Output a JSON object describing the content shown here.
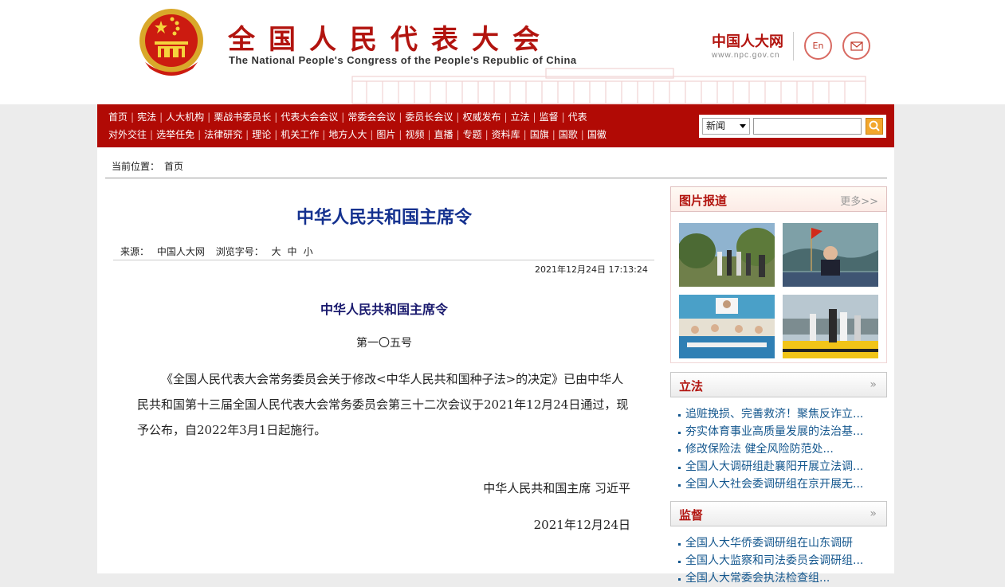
{
  "header": {
    "title_cn": "全国人民代表大会",
    "title_en": "The National People's Congress of the People's Republic of China",
    "npc_logo_cn": "中国人大网",
    "npc_logo_url": "www.npc.gov.cn",
    "en_button": "En",
    "mail_icon": "mail-icon",
    "emblem_icon": "national-emblem-icon",
    "brand_color": "#b2140f"
  },
  "nav": {
    "row1": [
      "首页",
      "宪法",
      "人大机构",
      "栗战书委员长",
      "代表大会会议",
      "常委会会议",
      "委员长会议",
      "权威发布",
      "立法",
      "监督",
      "代表"
    ],
    "row2": [
      "对外交往",
      "选举任免",
      "法律研究",
      "理论",
      "机关工作",
      "地方人大",
      "图片",
      "视频",
      "直播",
      "专题",
      "资料库",
      "国旗",
      "国歌",
      "国徽"
    ],
    "bg_color": "#b10a05"
  },
  "search": {
    "category": "新闻",
    "placeholder": "",
    "button_icon": "search-icon"
  },
  "breadcrumb": {
    "label": "当前位置：",
    "home": "首页"
  },
  "article": {
    "title": "中华人民共和国主席令",
    "source_label": "来源：",
    "source": "中国人大网",
    "font_label": "浏览字号：",
    "font_sizes": [
      "大",
      "中",
      "小"
    ],
    "datetime": "2021年12月24日 17:13:24",
    "order_title": "中华人民共和国主席令",
    "order_number": "第一〇五号",
    "body": "《全国人民代表大会常务委员会关于修改<中华人民共和国种子法>的决定》已由中华人民共和国第十三届全国人民代表大会常务委员会第三十二次会议于2021年12月24日通过，现予公布，自2022年3月1日起施行。",
    "signature": "中华人民共和国主席 习近平",
    "sign_date": "2021年12月24日"
  },
  "sidebar": {
    "photo_news": {
      "title": "图片报道",
      "more": "更多>>"
    },
    "legislation": {
      "title": "立法",
      "items": [
        "追赃挽损、完善救济！聚焦反诈立...",
        "夯实体育事业高质量发展的法治基...",
        "修改保险法 健全风险防范处...",
        "全国人大调研组赴襄阳开展立法调...",
        "全国人大社会委调研组在京开展无..."
      ]
    },
    "supervision": {
      "title": "监督",
      "items": [
        "全国人大华侨委调研组在山东调研",
        "全国人大监察和司法委员会调研组...",
        "全国人大常委会执法检查组..."
      ]
    }
  }
}
